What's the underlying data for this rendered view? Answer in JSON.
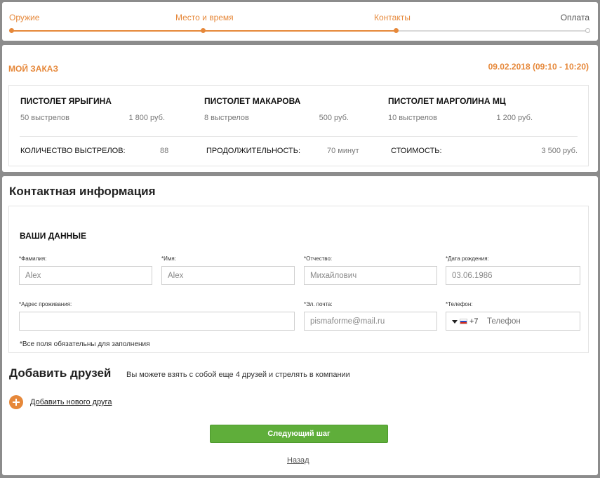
{
  "steps": [
    {
      "label": "Оружие",
      "state": "done"
    },
    {
      "label": "Место и время",
      "state": "done"
    },
    {
      "label": "Контакты",
      "state": "current"
    },
    {
      "label": "Оплата",
      "state": "todo"
    }
  ],
  "order": {
    "title": "МОЙ ЗАКАЗ",
    "date": "09.02.2018 (09:10 - 10:20)",
    "weapons": [
      {
        "name": "ПИСТОЛЕТ ЯРЫГИНА",
        "shots": "50 выстрелов",
        "price": "1 800 руб."
      },
      {
        "name": "ПИСТОЛЕТ МАКАРОВА",
        "shots": "8 выстрелов",
        "price": "500 руб."
      },
      {
        "name": "ПИСТОЛЕТ МАРГОЛИНА МЦ",
        "shots": "10 выстрелов",
        "price": "1 200 руб."
      }
    ],
    "summary": {
      "shots_label": "КОЛИЧЕСТВО ВЫСТРЕЛОВ:",
      "shots_value": "88",
      "duration_label": "ПРОДОЛЖИТЕЛЬНОСТЬ:",
      "duration_value": "70 минут",
      "cost_label": "СТОИМОСТЬ:",
      "cost_value": "3 500 руб."
    }
  },
  "contacts": {
    "title": "Контактная информация",
    "form_heading": "ВАШИ ДАННЫЕ",
    "fields": {
      "lastname": {
        "label": "*Фамилия:",
        "value": "Alex"
      },
      "firstname": {
        "label": "*Имя:",
        "value": "Alex"
      },
      "patronymic": {
        "label": "*Отчество:",
        "value": "Михайлович"
      },
      "birthdate": {
        "label": "*Дата рождения:",
        "value": "03.06.1986"
      },
      "address": {
        "label": "*Адрес проживания:",
        "value": ""
      },
      "email": {
        "label": "*Эл. почта:",
        "value": "pismaforme@mail.ru"
      },
      "phone": {
        "label": "*Телефон:",
        "code": "+7",
        "placeholder": "Телефон"
      }
    },
    "note": "*Все поля обязательны для заполнения"
  },
  "friends": {
    "title": "Добавить друзей",
    "hint": "Вы можете взять с собой еще 4 друзей и стрелять в компании",
    "add_label": "Добавить нового друга"
  },
  "actions": {
    "next": "Следующий шаг",
    "back": "Назад"
  },
  "colors": {
    "accent": "#e6883a",
    "primary_button": "#5fae3a"
  }
}
